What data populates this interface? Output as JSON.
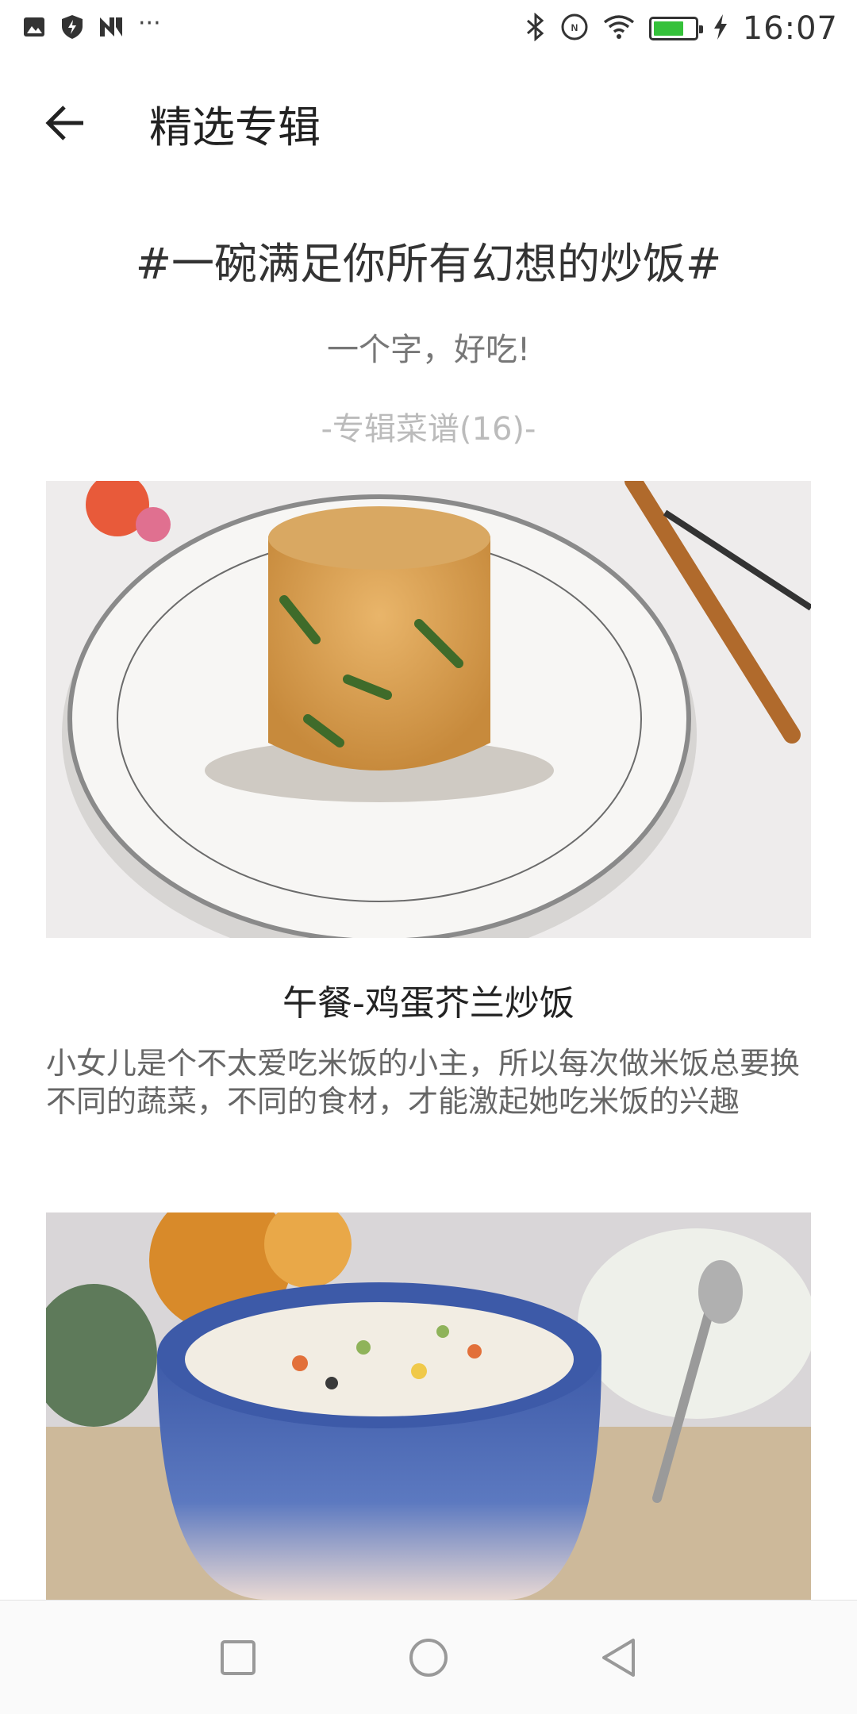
{
  "status_bar": {
    "time": "16:07",
    "overflow": "···",
    "left_icons": [
      "gallery-icon",
      "shield-bolt-icon",
      "n-app-icon"
    ],
    "right_icons": [
      "bluetooth-icon",
      "nfc-icon",
      "wifi-icon",
      "battery-icon",
      "charging-icon"
    ],
    "battery_level": 0.75,
    "battery_color": "#35c13a"
  },
  "app_bar": {
    "back_icon": "arrow-left-icon",
    "title": "精选专辑"
  },
  "album": {
    "title": "#一碗满足你所有幻想的炒饭#",
    "subtitle": "一个字，好吃!",
    "count_label": "-专辑菜谱(16)-"
  },
  "recipes": [
    {
      "title": "午餐-鸡蛋芥兰炒饭",
      "description": "小女儿是个不太爱吃米饭的小主，所以每次做米饭总要换不同的蔬菜，不同的食材，才能激起她吃米饭的兴趣"
    },
    {
      "title": "",
      "description": ""
    }
  ],
  "nav_bar": {
    "icons": [
      "recent-apps-icon",
      "home-icon",
      "back-triangle-icon"
    ]
  }
}
